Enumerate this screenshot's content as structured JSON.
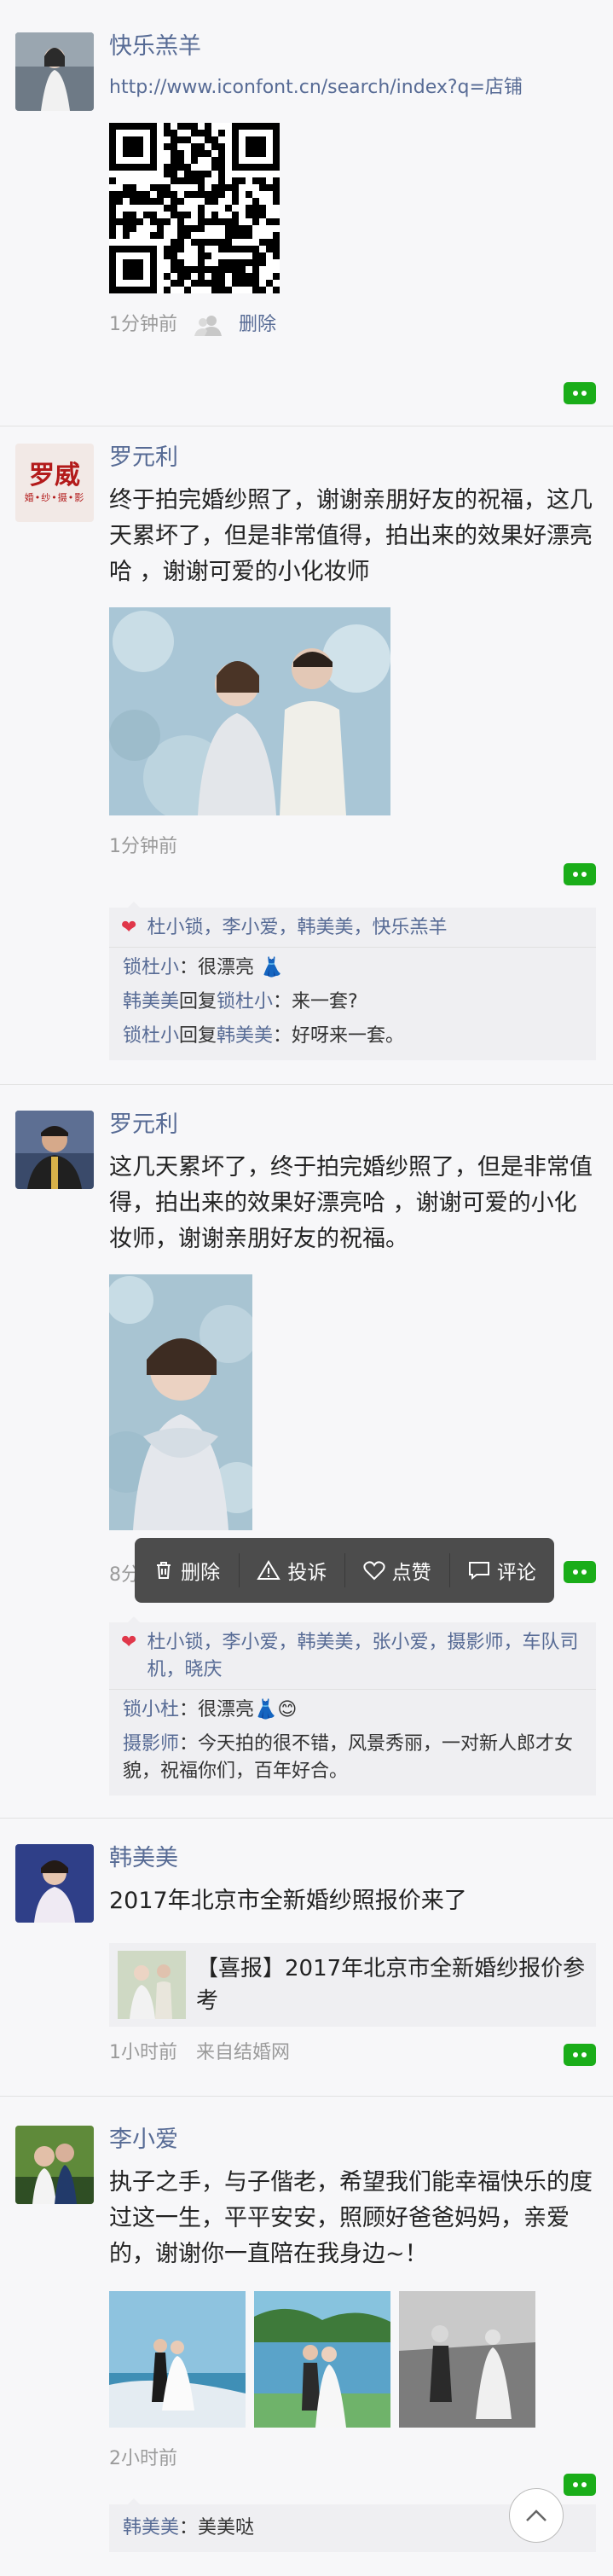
{
  "posts": [
    {
      "user": "快乐羔羊",
      "link": "http://www.iconfont.cn/search/index?q=店铺",
      "time": "1分钟前",
      "delete_label": "删除",
      "privacy_icon": "friends-icon"
    },
    {
      "user": "罗元利",
      "avatar_text": "罗威",
      "avatar_sub": "婚•纱•摄•影",
      "text": "终于拍完婚纱照了，谢谢亲朋好友的祝福，这几天累坏了，但是非常值得，拍出来的效果好漂亮哈 ，谢谢可爱的小化妆师",
      "time": "1分钟前",
      "likes": "杜小锁，李小爱，韩美美，快乐羔羊",
      "comments": [
        {
          "name": "锁杜小",
          "text": "：很漂亮 👗"
        },
        {
          "name": "韩美美",
          "reply_word": "回复",
          "reply_to": "锁杜小",
          "text": "：来一套?"
        },
        {
          "name": "锁杜小",
          "reply_word": "回复",
          "reply_to": "韩美美",
          "text": "：好呀来一套。"
        }
      ]
    },
    {
      "user": "罗元利",
      "text": "这几天累坏了，终于拍完婚纱照了，但是非常值得，拍出来的效果好漂亮哈 ，谢谢可爱的小化妆师，谢谢亲朋好友的祝福。",
      "time": "8分钟前",
      "likes": "杜小锁，李小爱，韩美美，张小爱，摄影师，车队司机，晓庆",
      "comments": [
        {
          "name": "锁小杜",
          "text": "：很漂亮👗😊"
        },
        {
          "name": "摄影师",
          "text": "：今天拍的很不错，风景秀丽，一对新人郎才女貌，祝福你们，百年好合。"
        }
      ]
    },
    {
      "user": "韩美美",
      "text": "2017年北京市全新婚纱照报价来了",
      "article_title": "【喜报】2017年北京市全新婚纱报价参考",
      "time": "1小时前",
      "source": "来自结婚网"
    },
    {
      "user": "李小爱",
      "text": "执子之手，与子偕老，希望我们能幸福快乐的度过这一生，平平安安，照顾好爸爸妈妈，亲爱的，谢谢你一直陪在我身边~！",
      "time": "2小时前",
      "comments": [
        {
          "name": "韩美美",
          "text": "：美美哒"
        }
      ]
    }
  ],
  "popup": {
    "delete": "删除",
    "report": "投诉",
    "like": "点赞",
    "comment": "评论"
  },
  "colors": {
    "name": "#576b95",
    "accent": "#1aad19",
    "like_heart": "#e0374a"
  }
}
